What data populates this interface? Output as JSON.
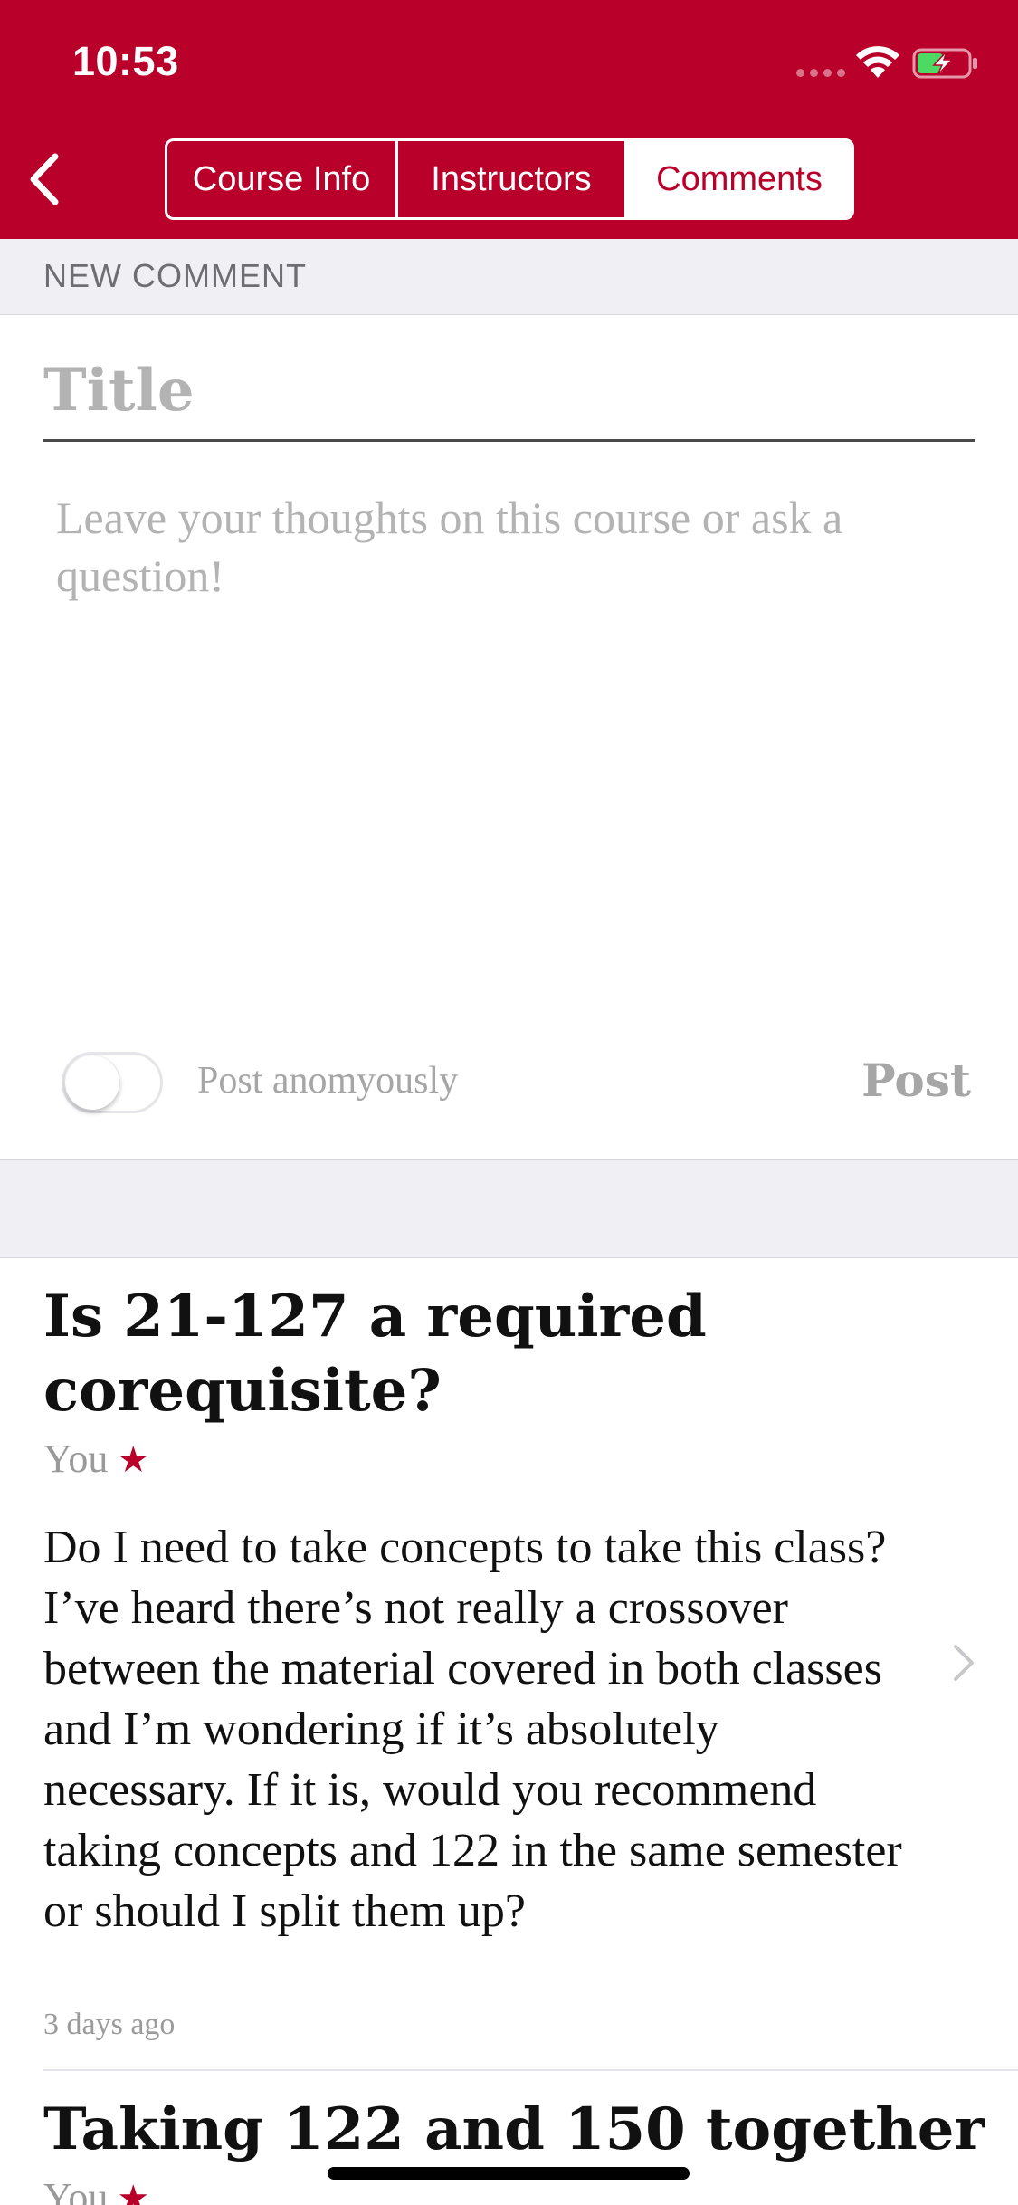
{
  "status_bar": {
    "time": "10:53"
  },
  "nav": {
    "back_icon": "chevron-left-icon",
    "tabs": [
      {
        "label": "Course Info",
        "selected": false
      },
      {
        "label": "Instructors",
        "selected": false
      },
      {
        "label": "Comments",
        "selected": true
      }
    ]
  },
  "new_comment": {
    "section_label": "NEW COMMENT",
    "title_placeholder": "Title",
    "body_placeholder": "Leave your thoughts on this course or ask a question!",
    "anonymous_label": "Post anomyously",
    "anonymous_enabled": false,
    "post_label": "Post"
  },
  "comments": [
    {
      "title": "Is 21-127 a required corequisite?",
      "author": "You",
      "star": "★",
      "body": "Do I need to take concepts to take this class?  I’ve heard there’s not really a crossover between the material covered in both classes and I’m wondering if it’s absolutely necessary.  If it is, would you recommend taking concepts and 122 in the same semester or should I split them up?",
      "time": "3 days ago"
    },
    {
      "title": "Taking 122 and 150 together",
      "author": "You",
      "star": "★"
    }
  ],
  "colors": {
    "brand": "#b8002a",
    "placeholder": "#b3b3b3",
    "section_bg": "#efeff4"
  }
}
